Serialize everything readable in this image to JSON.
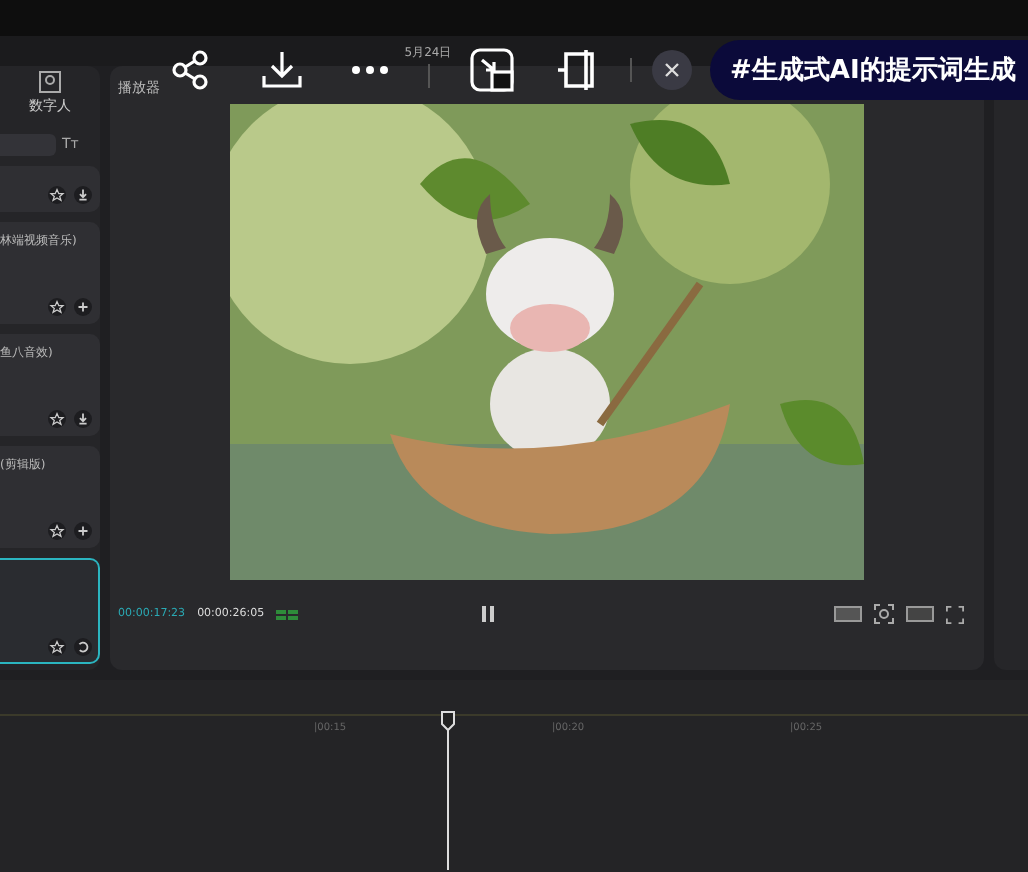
{
  "overlay_toolbar": {
    "date": "5月24日",
    "tag": "#生成式AI的提示词生成"
  },
  "left_panel": {
    "tab": "数字人",
    "filter": "Tт",
    "cards": [
      {
        "kind": "download",
        "selected": false
      },
      {
        "title": "林端视频音乐)",
        "kind": "add",
        "selected": false
      },
      {
        "title": "鱼八音效)",
        "kind": "download",
        "selected": false
      },
      {
        "title": "(剪辑版)",
        "kind": "add",
        "selected": false
      },
      {
        "kind": "undo",
        "selected": true
      }
    ]
  },
  "player": {
    "title": "播放器",
    "current_time": "00:00:17:23",
    "total_time": "00:00:26:05",
    "playing": true
  },
  "timeline": {
    "ruler": [
      "|00:15",
      "|00:20",
      "|00:25"
    ]
  }
}
